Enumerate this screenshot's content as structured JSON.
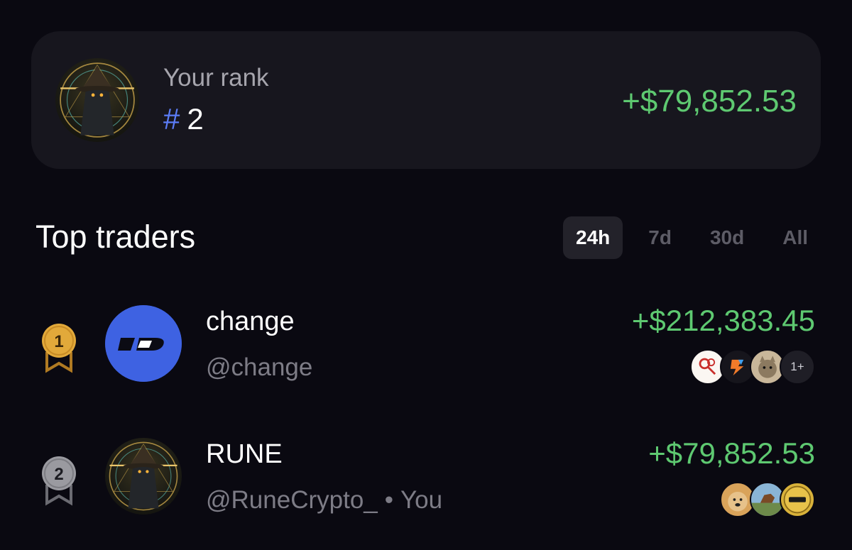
{
  "rank_card": {
    "label": "Your rank",
    "hash": "#",
    "rank": "2",
    "pnl": "+$79,852.53",
    "avatar_icon": "wizard-avatar"
  },
  "section": {
    "title": "Top traders",
    "tabs": [
      {
        "label": "24h",
        "active": true
      },
      {
        "label": "7d",
        "active": false
      },
      {
        "label": "30d",
        "active": false
      },
      {
        "label": "All",
        "active": false
      }
    ]
  },
  "traders": [
    {
      "position": "1",
      "medal": "gold-medal-icon",
      "name": "change",
      "handle": "@change",
      "you_marker": "",
      "pnl": "+$212,383.45",
      "tokens": [
        "keys-token-icon",
        "s-token-icon",
        "cat-token-icon"
      ],
      "more_tokens": "1+"
    },
    {
      "position": "2",
      "medal": "silver-medal-icon",
      "name": "RUNE",
      "handle": "@RuneCrypto_",
      "separator": "•",
      "you_marker": "You",
      "pnl": "+$79,852.53",
      "tokens": [
        "doge-token-icon",
        "horse-token-icon",
        "coin-token-icon"
      ]
    }
  ],
  "colors": {
    "background": "#0a0911",
    "card": "#17161e",
    "positive": "#5ec971",
    "rank_hash": "#5b7cf6",
    "gold": "#e2a93a",
    "silver": "#9a9aa0"
  }
}
